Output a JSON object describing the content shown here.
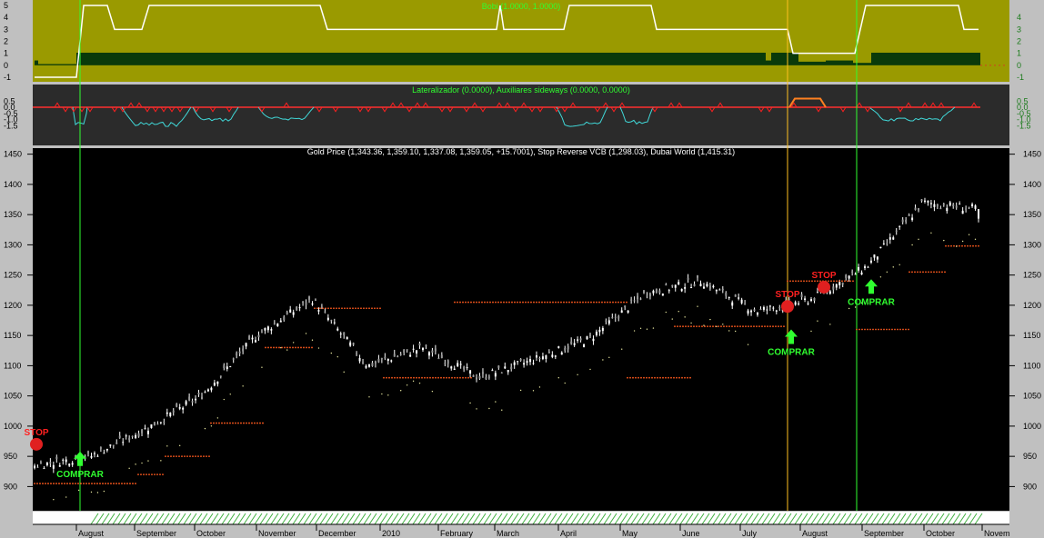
{
  "panels": {
    "top": {
      "title": "Bobi (1.0000, 1.0000)",
      "left_ticks": [
        "5",
        "4",
        "3",
        "2",
        "1",
        "0",
        "-1"
      ],
      "right_ticks": [
        "4",
        "3",
        "2",
        "1",
        "0",
        "-1"
      ],
      "colors": {
        "bg": "#9a9a00",
        "line": "#ffffff",
        "bar": "#0a3a0a"
      }
    },
    "mid": {
      "title": "Lateralizador (0.0000), Auxiliares sideways (0.0000, 0.0000)",
      "left_ticks": [
        "0.5",
        "0.0",
        "-0.5",
        "-1.0",
        "-1.5"
      ],
      "right_ticks": [
        "0.5",
        "0.0",
        "-0.5",
        "-1.0",
        "-1.5"
      ],
      "colors": {
        "bg": "#2b2b2b",
        "red": "#ff2020",
        "cyan": "#40d8d8",
        "orange": "#ff8020"
      }
    },
    "main": {
      "title": "Gold Price (1,343.36, 1,359.10, 1,337.08, 1,359.05, +15.7001), Stop Reverse VCB (1,298.03), Dubai World (1,415.31)",
      "colors": {
        "bg": "#000000",
        "stop_dots": "#ff5a1e",
        "dubai_dots": "#e8e8a0",
        "candle": "#ffffff"
      }
    }
  },
  "x_axis": {
    "months": [
      "August",
      "September",
      "October",
      "November",
      "December",
      "2010",
      "February",
      "March",
      "April",
      "May",
      "June",
      "July",
      "August",
      "September",
      "October",
      "Novem"
    ]
  },
  "signals": [
    {
      "label": "STOP",
      "type": "stop"
    },
    {
      "label": "COMPRAR",
      "type": "buy"
    },
    {
      "label": "STOP",
      "type": "stop"
    },
    {
      "label": "COMPRAR",
      "type": "buy"
    },
    {
      "label": "STOP",
      "type": "stop"
    },
    {
      "label": "COMPRAR",
      "type": "buy"
    }
  ],
  "chart_data": {
    "type": "candlestick",
    "title": "Gold Price (1,343.36, 1,359.10, 1,337.08, 1,359.05, +15.7001), Stop Reverse VCB (1,298.03), Dubai World (1,415.31)",
    "ylim": [
      860,
      1460
    ],
    "y_ticks": [
      900,
      950,
      1000,
      1050,
      1100,
      1150,
      1200,
      1250,
      1300,
      1350,
      1400,
      1450
    ],
    "x_labels": [
      "August",
      "September",
      "October",
      "November",
      "December",
      "2010",
      "February",
      "March",
      "April",
      "May",
      "June",
      "July",
      "August",
      "September",
      "October",
      "Novem"
    ],
    "price_path": [
      {
        "month": "start (late July 2009)",
        "close": 935
      },
      {
        "month": "August",
        "close": 950
      },
      {
        "month": "September",
        "close": 995
      },
      {
        "month": "October",
        "close": 1050
      },
      {
        "month": "November",
        "close": 1150
      },
      {
        "month": "December",
        "close": 1210
      },
      {
        "month": "December (late)",
        "close": 1100
      },
      {
        "month": "2010",
        "close": 1130
      },
      {
        "month": "February",
        "close": 1080
      },
      {
        "month": "March",
        "close": 1110
      },
      {
        "month": "April",
        "close": 1145
      },
      {
        "month": "May",
        "close": 1220
      },
      {
        "month": "June",
        "close": 1240
      },
      {
        "month": "July",
        "close": 1190
      },
      {
        "month": "August",
        "close": 1210
      },
      {
        "month": "September",
        "close": 1265
      },
      {
        "month": "October",
        "close": 1370
      },
      {
        "month": "end",
        "close": 1359.05
      }
    ],
    "last_bar": {
      "open": 1343.36,
      "high": 1359.1,
      "low": 1337.08,
      "close": 1359.05,
      "change": 15.7001
    },
    "stop_reverse_vcb_last": 1298.03,
    "dubai_world_last": 1415.31
  }
}
